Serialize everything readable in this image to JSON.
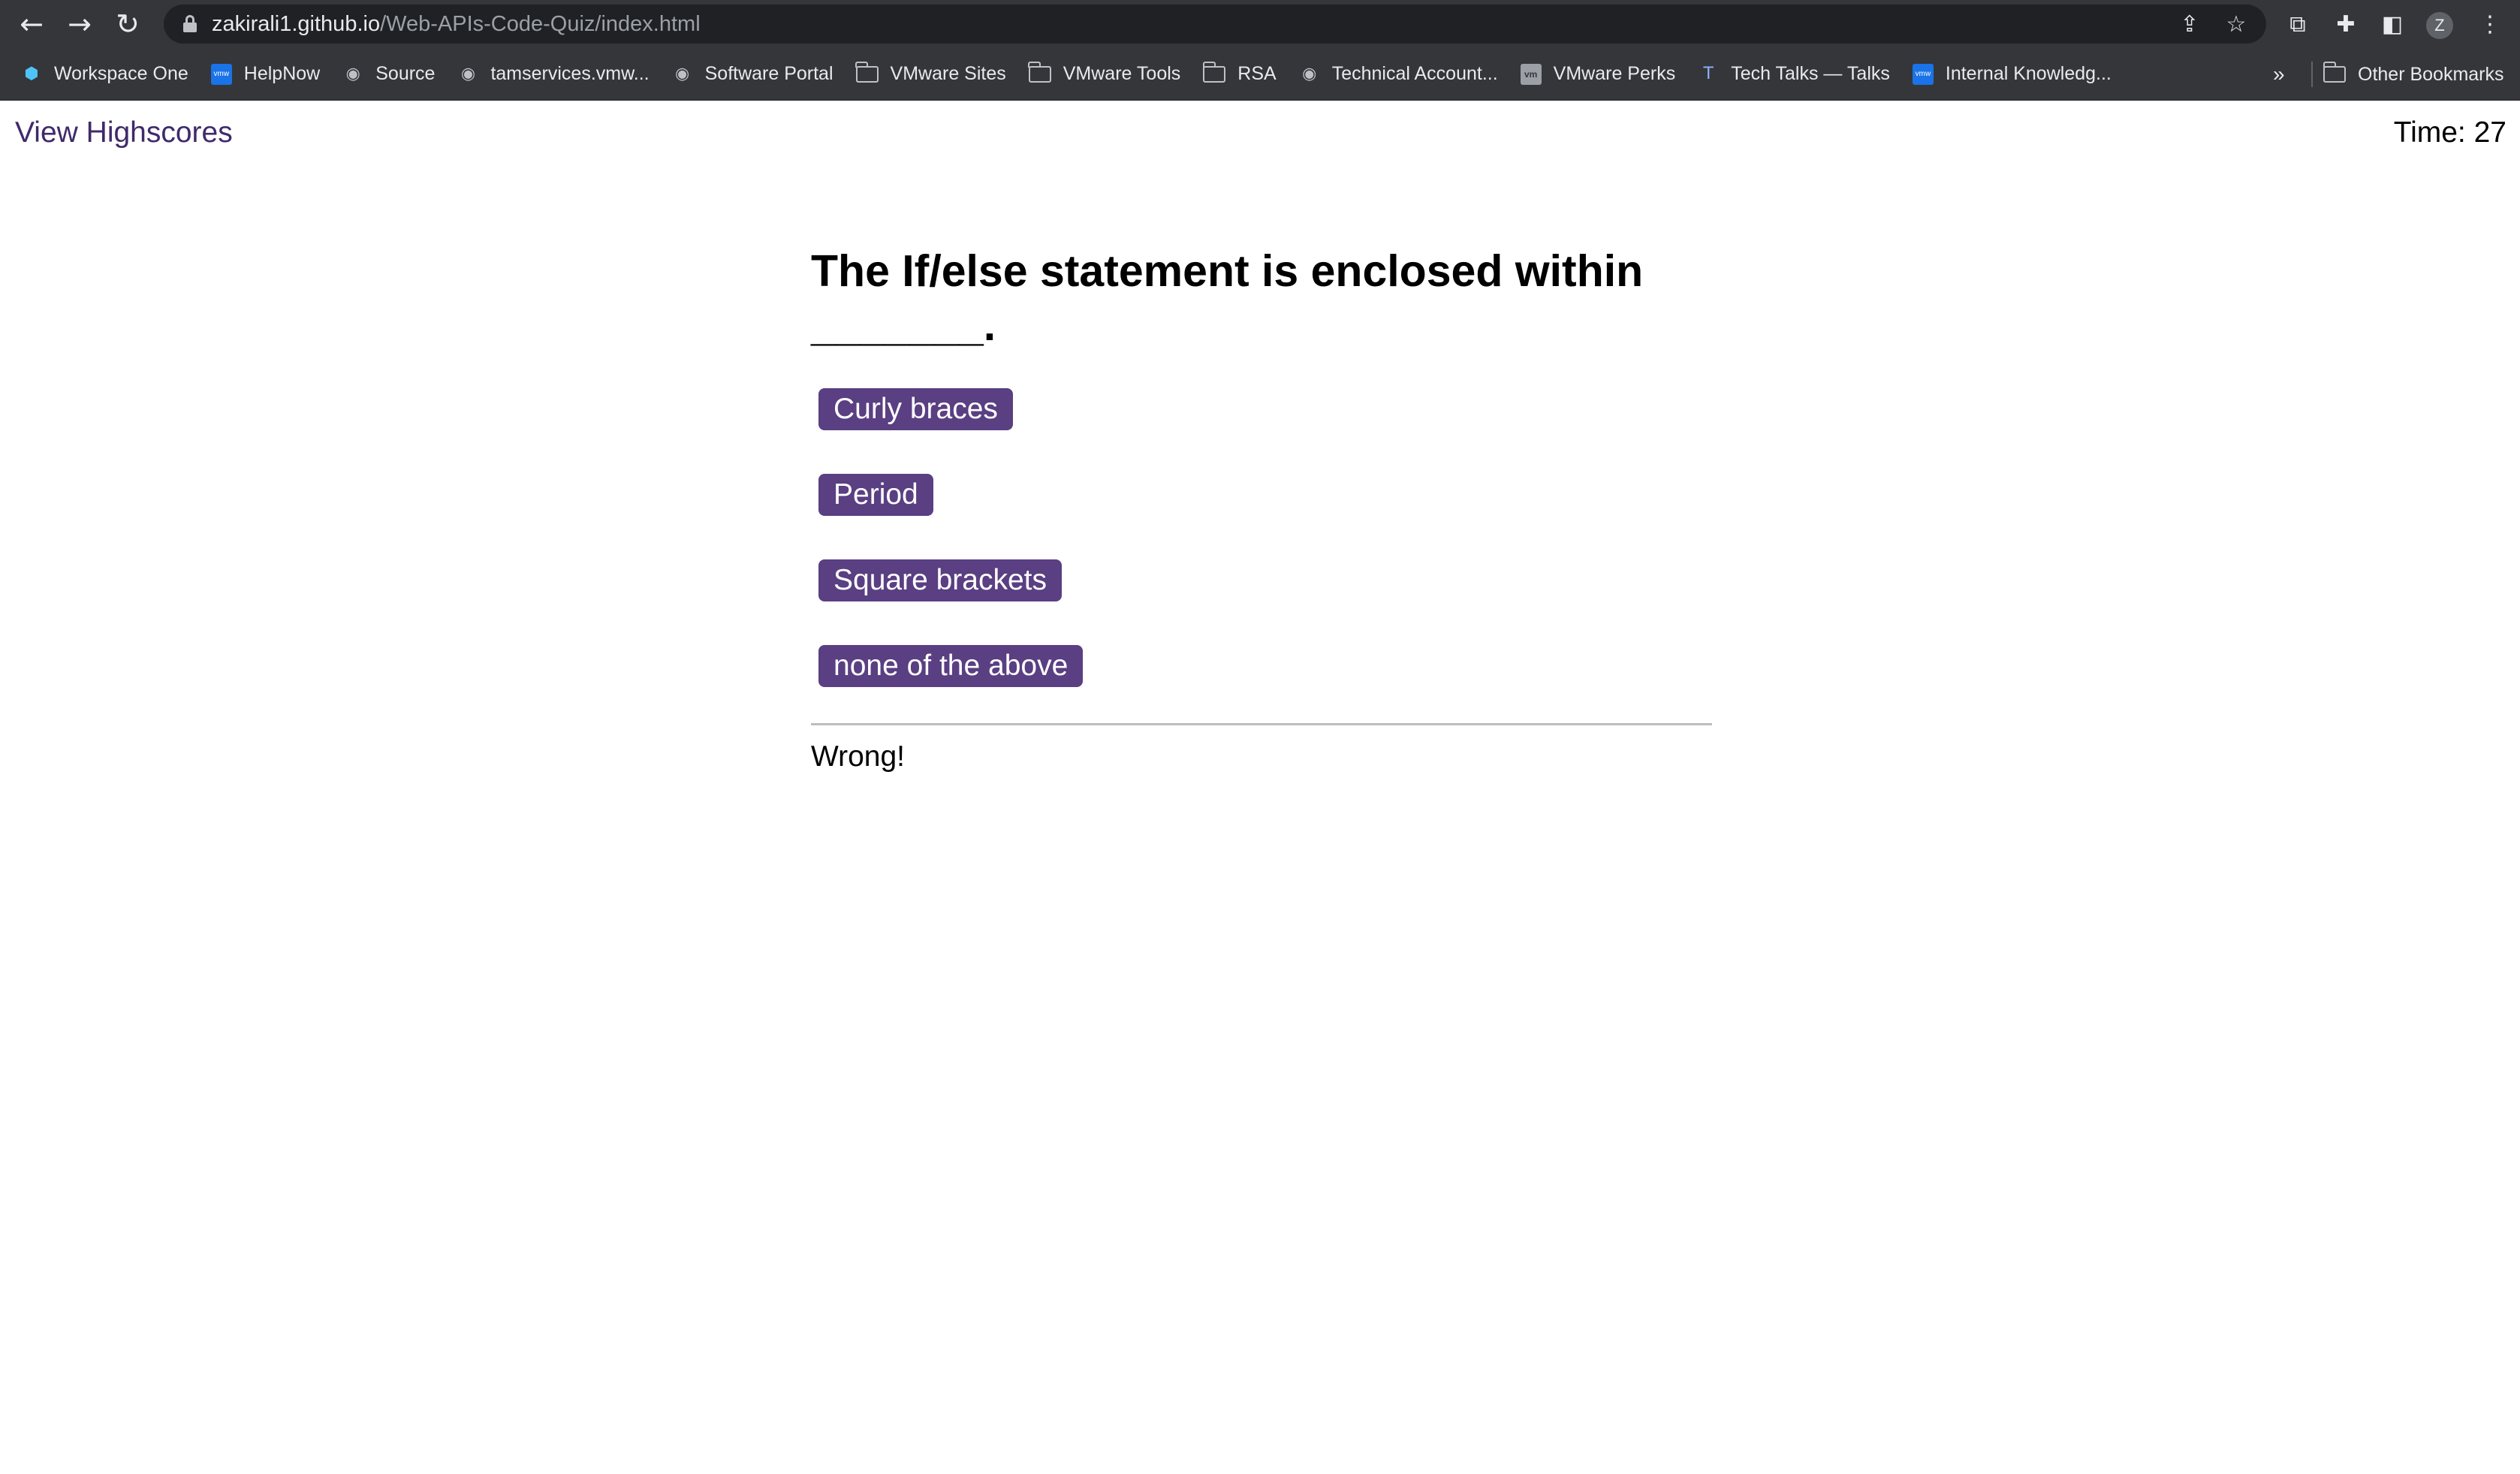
{
  "browser": {
    "url_host": "zakirali1.github.io",
    "url_path": "/Web-APIs-Code-Quiz/index.html",
    "profile_initial": "Z",
    "icons": {
      "back": "arrow-left-icon",
      "forward": "arrow-right-icon",
      "reload": "reload-icon",
      "lock": "lock-icon",
      "share": "share-icon",
      "bookmark_star": "star-icon",
      "extension_ext": "extension-icon",
      "extensions": "puzzle-icon",
      "side_panel": "side-panel-icon",
      "menu": "kebab-menu-icon"
    }
  },
  "bookmarks": {
    "items": [
      {
        "label": "Workspace One",
        "icon": "workspace-one-icon"
      },
      {
        "label": "HelpNow",
        "icon": "vmware-icon"
      },
      {
        "label": "Source",
        "icon": "globe-icon"
      },
      {
        "label": "tamservices.vmw...",
        "icon": "globe-icon"
      },
      {
        "label": "Software Portal",
        "icon": "globe-icon"
      },
      {
        "label": "VMware Sites",
        "icon": "folder-icon"
      },
      {
        "label": "VMware Tools",
        "icon": "folder-icon"
      },
      {
        "label": "RSA",
        "icon": "folder-icon"
      },
      {
        "label": "Technical Account...",
        "icon": "globe-icon"
      },
      {
        "label": "VMware Perks",
        "icon": "vm-icon"
      },
      {
        "label": "Tech Talks — Talks",
        "icon": "tech-talks-icon"
      },
      {
        "label": "Internal Knowledg...",
        "icon": "vmware-icon"
      }
    ],
    "more": "»",
    "other": "Other Bookmarks"
  },
  "page": {
    "highscores_link": "View Highscores",
    "timer_label": "Time:",
    "timer_value": "27"
  },
  "quiz": {
    "question": "The If/else statement is enclosed within _______.",
    "answers": [
      "Curly braces",
      "Period",
      "Square brackets",
      "none of the above"
    ],
    "feedback": "Wrong!"
  },
  "colors": {
    "accent": "#5a3f82",
    "link": "#3f2a6b",
    "chrome_bg": "#35363a"
  }
}
